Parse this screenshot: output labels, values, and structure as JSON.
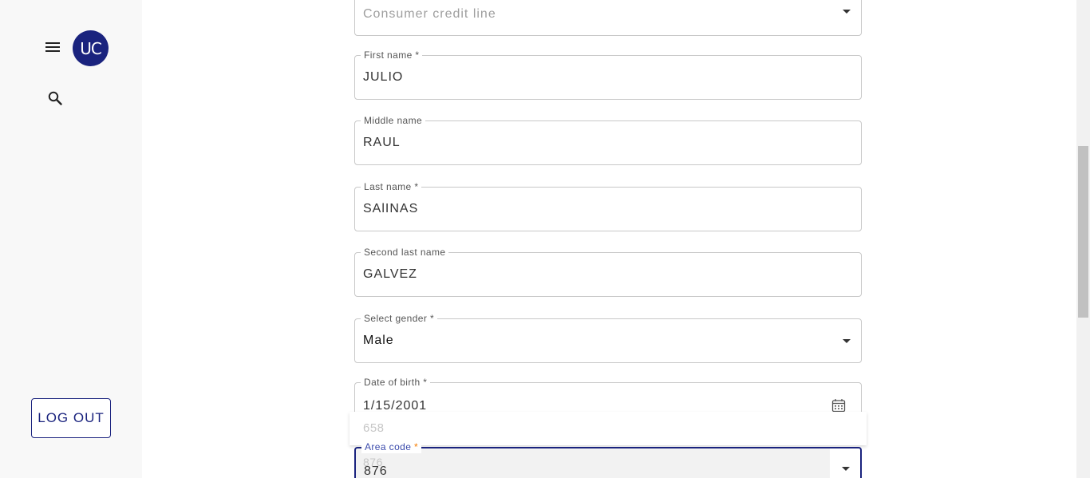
{
  "sidebar": {
    "avatar_text": "UC",
    "logout_label": "LOG OUT",
    "icons": {
      "menu": "hamburger-menu-icon",
      "search": "search-icon"
    }
  },
  "form": {
    "credit_line": {
      "value": "Consumer credit line"
    },
    "first_name": {
      "label": "First name *",
      "value": "JULIO"
    },
    "middle_name": {
      "label": "Middle name",
      "value": "RAUL"
    },
    "last_name": {
      "label": "Last name *",
      "value": "SAlINAS"
    },
    "second_last_name": {
      "label": "Second last name",
      "value": "GALVEZ"
    },
    "gender": {
      "label": "Select gender *",
      "value": "Male"
    },
    "dob": {
      "label": "Date of birth *",
      "value": "1/15/2001"
    },
    "area_code": {
      "label": "Area code",
      "required_mark": "*",
      "value": "876",
      "suggestions": [
        "658",
        "876"
      ]
    }
  },
  "colors": {
    "primary": "#1a237e",
    "focus_label": "#3949ab",
    "required": "#f57c00",
    "border": "#c8c8c8"
  }
}
